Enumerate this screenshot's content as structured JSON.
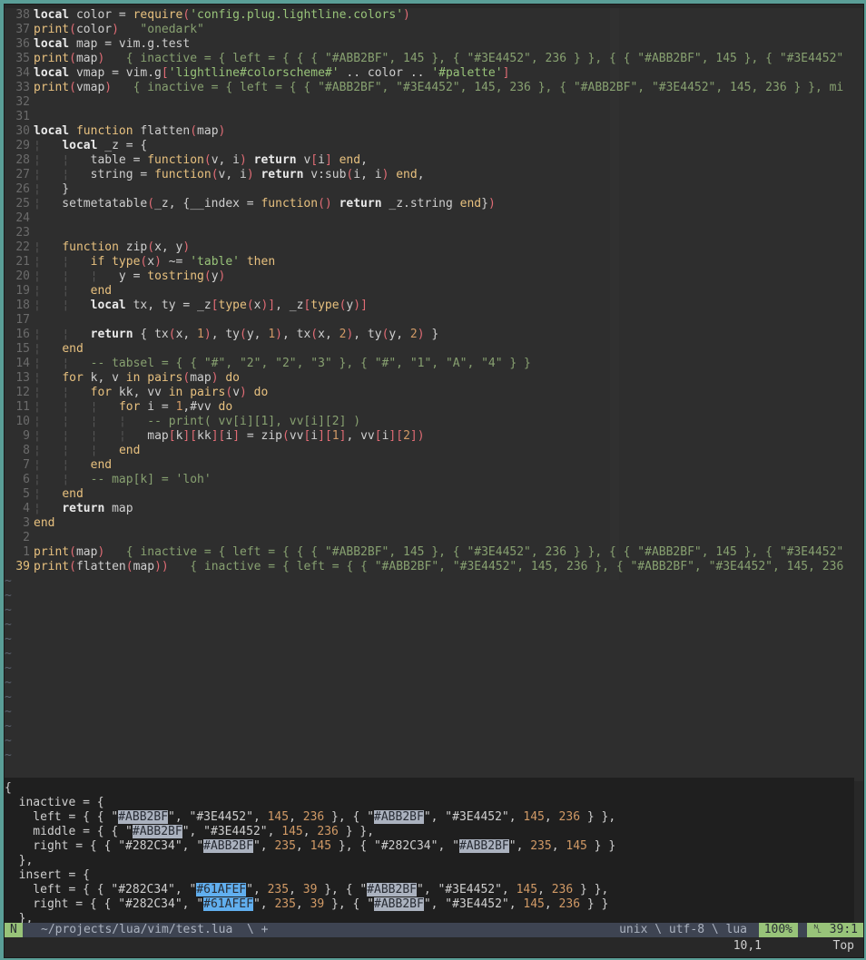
{
  "editor": {
    "lines": [
      {
        "n": "38",
        "html": "<span class='kw'>local</span> color = <span class='fn'>require</span><span class='par'>(</span><span class='str'>'config.plug.lightline.colors'</span><span class='par'>)</span>"
      },
      {
        "n": "37",
        "html": "<span class='fn'>print</span><span class='par'>(</span>color<span class='par'>)</span>   <span class='vt'>\"onedark\"</span>"
      },
      {
        "n": "36",
        "html": "<span class='kw'>local</span> map = vim.g.test"
      },
      {
        "n": "35",
        "html": "<span class='fn'>print</span><span class='par'>(</span>map<span class='par'>)</span>   <span class='vt'>{ inactive = { left = { { { \"#ABB2BF\", 145 }, { \"#3E4452\", 236 } }, { { \"#ABB2BF\", 145 }, { \"#3E4452\"</span>"
      },
      {
        "n": "34",
        "html": "<span class='kw'>local</span> vmap = vim.g<span class='par'>[</span><span class='str'>'lightline#colorscheme#'</span> .. color .. <span class='str'>'#palette'</span><span class='par'>]</span>"
      },
      {
        "n": "33",
        "html": "<span class='fn'>print</span><span class='par'>(</span>vmap<span class='par'>)</span>   <span class='vt'>{ inactive = { left = { { \"#ABB2BF\", \"#3E4452\", 145, 236 }, { \"#ABB2BF\", \"#3E4452\", 145, 236 } }, mi</span>"
      },
      {
        "n": "32",
        "html": ""
      },
      {
        "n": "31",
        "html": ""
      },
      {
        "n": "30",
        "html": "<span class='kw'>local</span> <span class='fn'>function</span> flatten<span class='par'>(</span>map<span class='par'>)</span>"
      },
      {
        "n": "29",
        "html": "<span class='ind'>¦</span>   <span class='kw'>local</span> _z = {"
      },
      {
        "n": "28",
        "html": "<span class='ind'>¦</span>   <span class='ind'>¦</span>   table = <span class='fn'>function</span><span class='par'>(</span>v, i<span class='par'>)</span> <span class='kw'>return</span> v<span class='par'>[</span>i<span class='par'>]</span> <span class='fn'>end</span>,"
      },
      {
        "n": "27",
        "html": "<span class='ind'>¦</span>   <span class='ind'>¦</span>   string = <span class='fn'>function</span><span class='par'>(</span>v, i<span class='par'>)</span> <span class='kw'>return</span> v:sub<span class='par'>(</span>i, i<span class='par'>)</span> <span class='fn'>end</span>,"
      },
      {
        "n": "26",
        "html": "<span class='ind'>¦</span>   }"
      },
      {
        "n": "25",
        "html": "<span class='ind'>¦</span>   setmetatable<span class='par'>(</span>_z, {__index = <span class='fn'>function</span><span class='par'>()</span> <span class='kw'>return</span> _z.string <span class='fn'>end</span>}<span class='par'>)</span>"
      },
      {
        "n": "24",
        "html": ""
      },
      {
        "n": "23",
        "html": ""
      },
      {
        "n": "22",
        "html": "<span class='ind'>¦</span>   <span class='fn'>function</span> zip<span class='par'>(</span>x, y<span class='par'>)</span>"
      },
      {
        "n": "21",
        "html": "<span class='ind'>¦</span>   <span class='ind'>¦</span>   <span class='fn'>if</span> <span class='fn'>type</span><span class='par'>(</span>x<span class='par'>)</span> ~= <span class='str'>'table'</span> <span class='fn'>then</span>"
      },
      {
        "n": "20",
        "html": "<span class='ind'>¦</span>   <span class='ind'>¦</span>   <span class='ind'>¦</span>   y = <span class='fn'>tostring</span><span class='par'>(</span>y<span class='par'>)</span>"
      },
      {
        "n": "19",
        "html": "<span class='ind'>¦</span>   <span class='ind'>¦</span>   <span class='fn'>end</span>"
      },
      {
        "n": "18",
        "html": "<span class='ind'>¦</span>   <span class='ind'>¦</span>   <span class='kw'>local</span> tx, ty = _z<span class='par'>[</span><span class='fn'>type</span><span class='par'>(</span>x<span class='par'>)]</span>, _z<span class='par'>[</span><span class='fn'>type</span><span class='par'>(</span>y<span class='par'>)]</span>"
      },
      {
        "n": "17",
        "html": ""
      },
      {
        "n": "16",
        "html": "<span class='ind'>¦</span>   <span class='ind'>¦</span>   <span class='kw'>return</span> { tx<span class='par'>(</span>x, <span class='num'>1</span><span class='par'>)</span>, ty<span class='par'>(</span>y, <span class='num'>1</span><span class='par'>)</span>, tx<span class='par'>(</span>x, <span class='num'>2</span><span class='par'>)</span>, ty<span class='par'>(</span>y, <span class='num'>2</span><span class='par'>)</span> }"
      },
      {
        "n": "15",
        "html": "<span class='ind'>¦</span>   <span class='fn'>end</span>"
      },
      {
        "n": "14",
        "html": "<span class='ind'>¦</span>   <span class='ind'>¦</span>   <span class='vt'>-- tabsel = { { \"#\", \"2\", \"2\", \"3\" }, { \"#\", \"1\", \"A\", \"4\" } }</span>"
      },
      {
        "n": "13",
        "html": "<span class='ind'>¦</span>   <span class='fn'>for</span> k, v <span class='fn'>in</span> <span class='fn'>pairs</span><span class='par'>(</span>map<span class='par'>)</span> <span class='fn'>do</span>"
      },
      {
        "n": "12",
        "html": "<span class='ind'>¦</span>   <span class='ind'>¦</span>   <span class='fn'>for</span> kk, vv <span class='fn'>in</span> <span class='fn'>pairs</span><span class='par'>(</span>v<span class='par'>)</span> <span class='fn'>do</span>"
      },
      {
        "n": "11",
        "html": "<span class='ind'>¦</span>   <span class='ind'>¦</span>   <span class='ind'>¦</span>   <span class='fn'>for</span> i = <span class='num'>1</span>,#vv <span class='fn'>do</span>"
      },
      {
        "n": "10",
        "html": "<span class='ind'>¦</span>   <span class='ind'>¦</span>   <span class='ind'>¦</span>   <span class='ind'>¦</span>   <span class='vt'>-- print( vv[i][1], vv[i][2] )</span>"
      },
      {
        "n": "9",
        "html": "<span class='ind'>¦</span>   <span class='ind'>¦</span>   <span class='ind'>¦</span>   <span class='ind'>¦</span>   map<span class='par'>[</span>k<span class='par'>][</span>kk<span class='par'>][</span>i<span class='par'>]</span> = zip<span class='par'>(</span>vv<span class='par'>[</span>i<span class='par'>][</span><span class='num'>1</span><span class='par'>]</span>, vv<span class='par'>[</span>i<span class='par'>][</span><span class='num'>2</span><span class='par'>])</span>"
      },
      {
        "n": "8",
        "html": "<span class='ind'>¦</span>   <span class='ind'>¦</span>   <span class='ind'>¦</span>   <span class='fn'>end</span>"
      },
      {
        "n": "7",
        "html": "<span class='ind'>¦</span>   <span class='ind'>¦</span>   <span class='fn'>end</span>"
      },
      {
        "n": "6",
        "html": "<span class='ind'>¦</span>   <span class='ind'>¦</span>   <span class='vt'>-- map[k] = 'loh'</span>"
      },
      {
        "n": "5",
        "html": "<span class='ind'>¦</span>   <span class='fn'>end</span>"
      },
      {
        "n": "4",
        "html": "<span class='ind'>¦</span>   <span class='kw'>return</span> map"
      },
      {
        "n": "3",
        "html": "<span class='fn'>end</span>"
      },
      {
        "n": "2",
        "html": ""
      },
      {
        "n": "1",
        "html": "<span class='fn'>print</span><span class='par'>(</span>map<span class='par'>)</span>   <span class='vt'>{ inactive = { left = { { { \"#ABB2BF\", 145 }, { \"#3E4452\", 236 } }, { { \"#ABB2BF\", 145 }, { \"#3E4452\"</span>"
      },
      {
        "n": "39",
        "cur": true,
        "html": "<span class='fn'>print</span><span class='par'>(</span>flatten<span class='par'>(</span>map<span class='par'>))</span>   <span class='vt'>{ inactive = { left = { { \"#ABB2BF\", \"#3E4452\", 145, 236 }, { \"#ABB2BF\", \"#3E4452\", 145, 236</span>"
      }
    ],
    "tilde_count": 13
  },
  "popup": {
    "lines": [
      "{",
      "  inactive = {",
      "    left = { { \"<span class='hl'>#ABB2BF</span>\", \"#3E4452\", <span class='pnum'>145</span>, <span class='pnum'>236</span> }, { \"<span class='hl'>#ABB2BF</span>\", \"#3E4452\", <span class='pnum'>145</span>, <span class='pnum'>236</span> } },",
      "    middle = { { \"<span class='hl'>#ABB2BF</span>\", \"#3E4452\", <span class='pnum'>145</span>, <span class='pnum'>236</span> } },",
      "    right = { { \"#282C34\", \"<span class='hl'>#ABB2BF</span>\", <span class='pnum'>235</span>, <span class='pnum'>145</span> }, { \"#282C34\", \"<span class='hl'>#ABB2BF</span>\", <span class='pnum'>235</span>, <span class='pnum'>145</span> } }",
      "  },",
      "  insert = {",
      "    left = { { \"#282C34\", \"<span class='hlb'>#61AFEF</span>\", <span class='pnum'>235</span>, <span class='pnum'>39</span> }, { \"<span class='hl'>#ABB2BF</span>\", \"#3E4452\", <span class='pnum'>145</span>, <span class='pnum'>236</span> } },",
      "    right = { { \"#282C34\", \"<span class='hlb'>#61AFEF</span>\", <span class='pnum'>235</span>, <span class='pnum'>39</span> }, { \"<span class='hl'>#ABB2BF</span>\", \"#3E4452\", <span class='pnum'>145</span>, <span class='pnum'>236</span> } }",
      "  },"
    ]
  },
  "statusline": {
    "mode": "N",
    "file": "~/projects/lua/vim/test.lua  \\ +",
    "right": "unix \\ utf-8 \\ lua",
    "percent": "100%",
    "position": "␤ 39:1"
  },
  "cmdline": {
    "ruler": "10,1",
    "top": "Top"
  }
}
